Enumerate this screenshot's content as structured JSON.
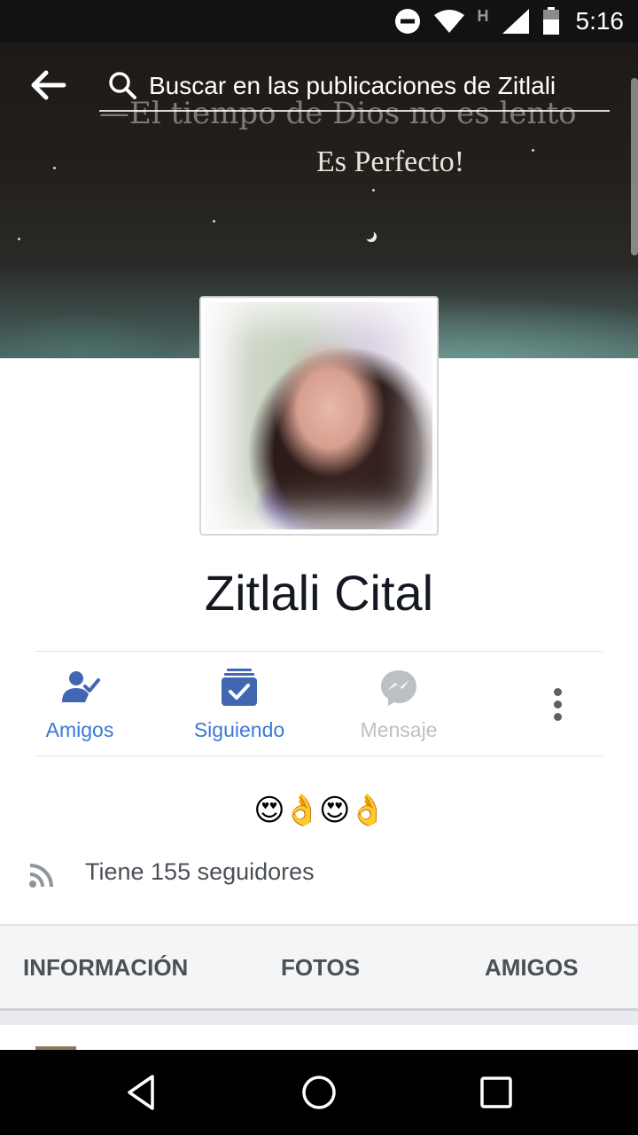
{
  "status_bar": {
    "time": "5:16",
    "icons": [
      "do-not-disturb-icon",
      "wifi-icon",
      "h-network-icon",
      "signal-icon",
      "battery-icon"
    ],
    "network_letter": "H"
  },
  "cover": {
    "text_ghost": "—El tiempo de Dios no es lento",
    "text_main": "Es Perfecto!"
  },
  "search": {
    "placeholder": "Buscar en las publicaciones de Zitlali"
  },
  "profile": {
    "name": "Zitlali Cital"
  },
  "actions": {
    "friends_label": "Amigos",
    "following_label": "Siguiendo",
    "message_label": "Mensaje"
  },
  "bio": {
    "emojis": "😍👌😍👌"
  },
  "followers": {
    "text": "Tiene 155 seguidores"
  },
  "tabs": {
    "info": "INFORMACIÓN",
    "photos": "FOTOS",
    "friends": "AMIGOS"
  },
  "colors": {
    "accent": "#4267b2",
    "link_blue": "#3b78d8",
    "disabled_gray": "#bcc0c4",
    "text_dark": "#141823",
    "text_muted": "#4b4f56"
  }
}
